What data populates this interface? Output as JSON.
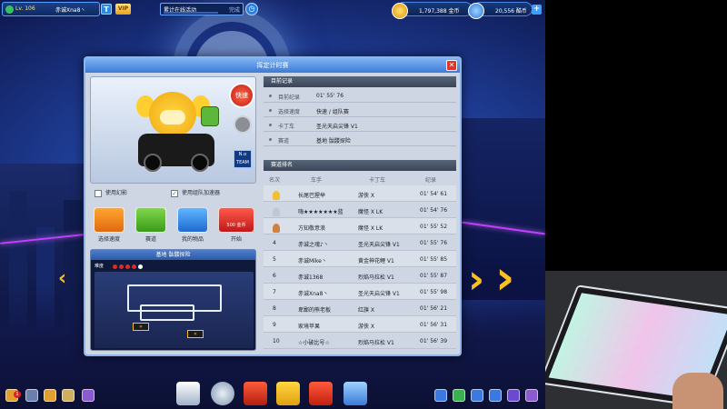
{
  "topbar": {
    "level": "Lv. 106",
    "player_name": "赤诚Xna8丶",
    "t_badge": "T",
    "vip": "VIP",
    "event_label": "累计在线活动",
    "event_status": "完成",
    "coins": "1,797,388 金币",
    "kcoins": "20,556 酷币",
    "plus": "+"
  },
  "dialog": {
    "title": "挥定计时赛",
    "close": "✕",
    "left": {
      "kuaisu": "快速",
      "team_badge_top": "N.o",
      "team_badge_bottom": "TEAM",
      "check_phantom": "使用幻影",
      "check_team_boost": "使用组队加速器",
      "actions": [
        {
          "label": "选择速度"
        },
        {
          "label": "赛道"
        },
        {
          "label": "我的物品"
        },
        {
          "label": "开始",
          "badge": "500 金币"
        }
      ],
      "track_title": "基地 骷髅探险",
      "difficulty_label": "难度"
    },
    "record": {
      "heading": "目前记录",
      "rows": [
        {
          "k": "目前纪录",
          "v": "01' 55' 76"
        },
        {
          "k": "选择速度",
          "v": "快速 / 组队赛"
        },
        {
          "k": "卡丁车",
          "v": "圣光天启尖锋 V1"
        },
        {
          "k": "赛道",
          "v": "基地 骷髅探险"
        }
      ]
    },
    "ranking": {
      "heading": "赛道排名",
      "columns": [
        "名次",
        "车手",
        "卡丁车",
        "纪录"
      ],
      "rows": [
        {
          "rank": "1",
          "driver": "长尾巴猩举",
          "kart": "游侠 X",
          "time": "01' 54' 61"
        },
        {
          "rank": "2",
          "driver": "嗨★★★★★★★蓝",
          "kart": "魔怪 X LK",
          "time": "01' 54' 76"
        },
        {
          "rank": "3",
          "driver": "方知敬意浪",
          "kart": "魔怪 X LK",
          "time": "01' 55' 52"
        },
        {
          "rank": "4",
          "driver": "赤诚之魂♪丶",
          "kart": "圣光天启尖锋 V1",
          "time": "01' 55' 76"
        },
        {
          "rank": "5",
          "driver": "赤诚Mike丶",
          "kart": "黄金神花鲤 V1",
          "time": "01' 55' 85"
        },
        {
          "rank": "6",
          "driver": "赤诚1368",
          "kart": "烈焰马拉松 V1",
          "time": "01' 55' 87"
        },
        {
          "rank": "7",
          "driver": "赤诚Xna8丶",
          "kart": "圣光天启尖锋 V1",
          "time": "01' 55' 98"
        },
        {
          "rank": "8",
          "driver": "卑鄙的熊老板",
          "kart": "红旗 X",
          "time": "01' 56' 21"
        },
        {
          "rank": "9",
          "driver": "家境苹果",
          "kart": "游侠 X",
          "time": "01' 56' 31"
        },
        {
          "rank": "10",
          "driver": "☆小破比号☆",
          "kart": "烈焰马拉松 V1",
          "time": "01' 56' 39"
        }
      ]
    }
  },
  "bottom": {
    "notify_count": "1"
  },
  "colors": {
    "title_bar": "#3d7ad4",
    "dialog_bg": "#cdd6e2",
    "accent_gold": "#f8c020",
    "close_red": "#e0342a"
  }
}
